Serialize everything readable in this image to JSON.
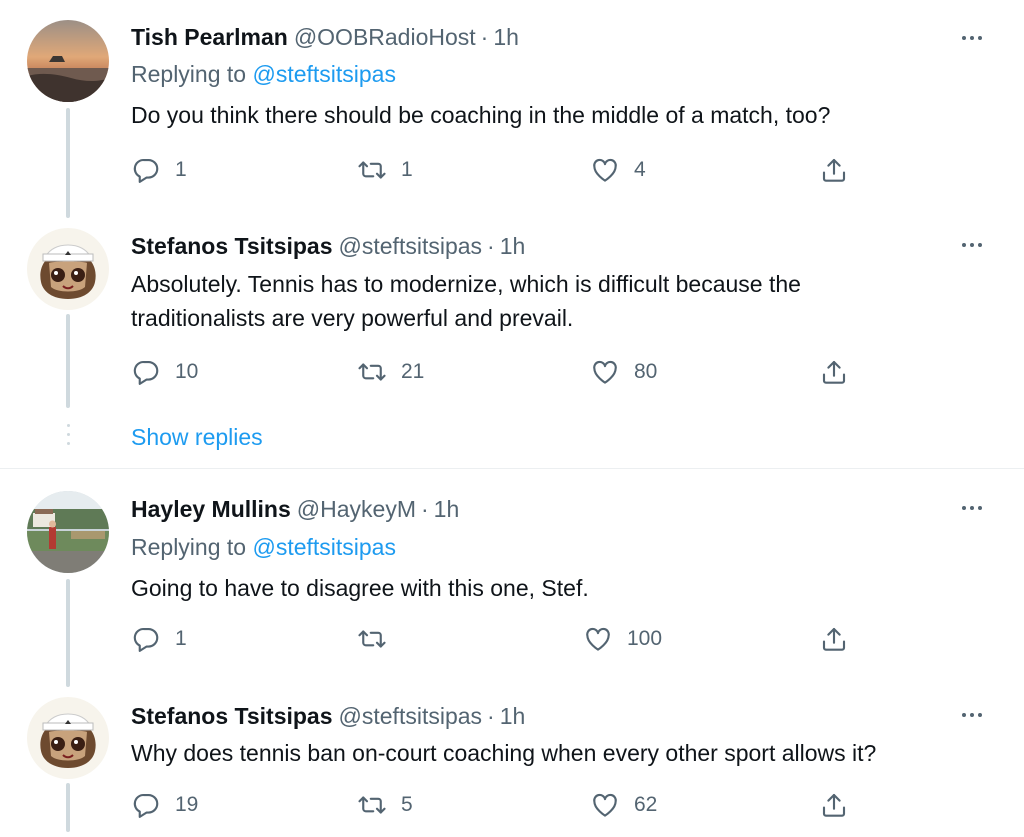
{
  "tweets": [
    {
      "name": "Tish Pearlman",
      "handle": "@OOBRadioHost",
      "separator": "·",
      "time": "1h",
      "replying_prefix": "Replying to",
      "replying_to": "@steftsitsipas",
      "text": "Do you think there should be coaching in the middle of a match, too?",
      "replies": "1",
      "retweets": "1",
      "likes": "4",
      "avatar": "sunset-seascape"
    },
    {
      "name": "Stefanos Tsitsipas",
      "handle": "@steftsitsipas",
      "separator": "·",
      "time": "1h",
      "text_line1": "Absolutely. Tennis has to modernize, which is difficult because the",
      "text_line2": "traditionalists are very powerful and prevail.",
      "replies": "10",
      "retweets": "21",
      "likes": "80",
      "avatar": "cartoon-tennis-player"
    },
    {
      "name": "Hayley Mullins",
      "handle": "@HaykeyM",
      "separator": "·",
      "time": "1h",
      "replying_prefix": "Replying to",
      "replying_to": "@steftsitsipas",
      "text": "Going to have to disagree with this one, Stef.",
      "replies": "1",
      "retweets": "",
      "likes": "100",
      "avatar": "outdoor-photo"
    },
    {
      "name": "Stefanos Tsitsipas",
      "handle": "@steftsitsipas",
      "separator": "·",
      "time": "1h",
      "text": "Why does tennis ban on-court coaching when every other sport allows it?",
      "replies": "19",
      "retweets": "5",
      "likes": "62",
      "avatar": "cartoon-tennis-player"
    }
  ],
  "show_replies": "Show replies",
  "colors": {
    "text": "#0f1419",
    "secondary": "#536471",
    "link": "#1d9bf0",
    "thread": "#cfd9de"
  },
  "icons": [
    "reply-icon",
    "retweet-icon",
    "like-icon",
    "share-icon",
    "more-icon"
  ]
}
